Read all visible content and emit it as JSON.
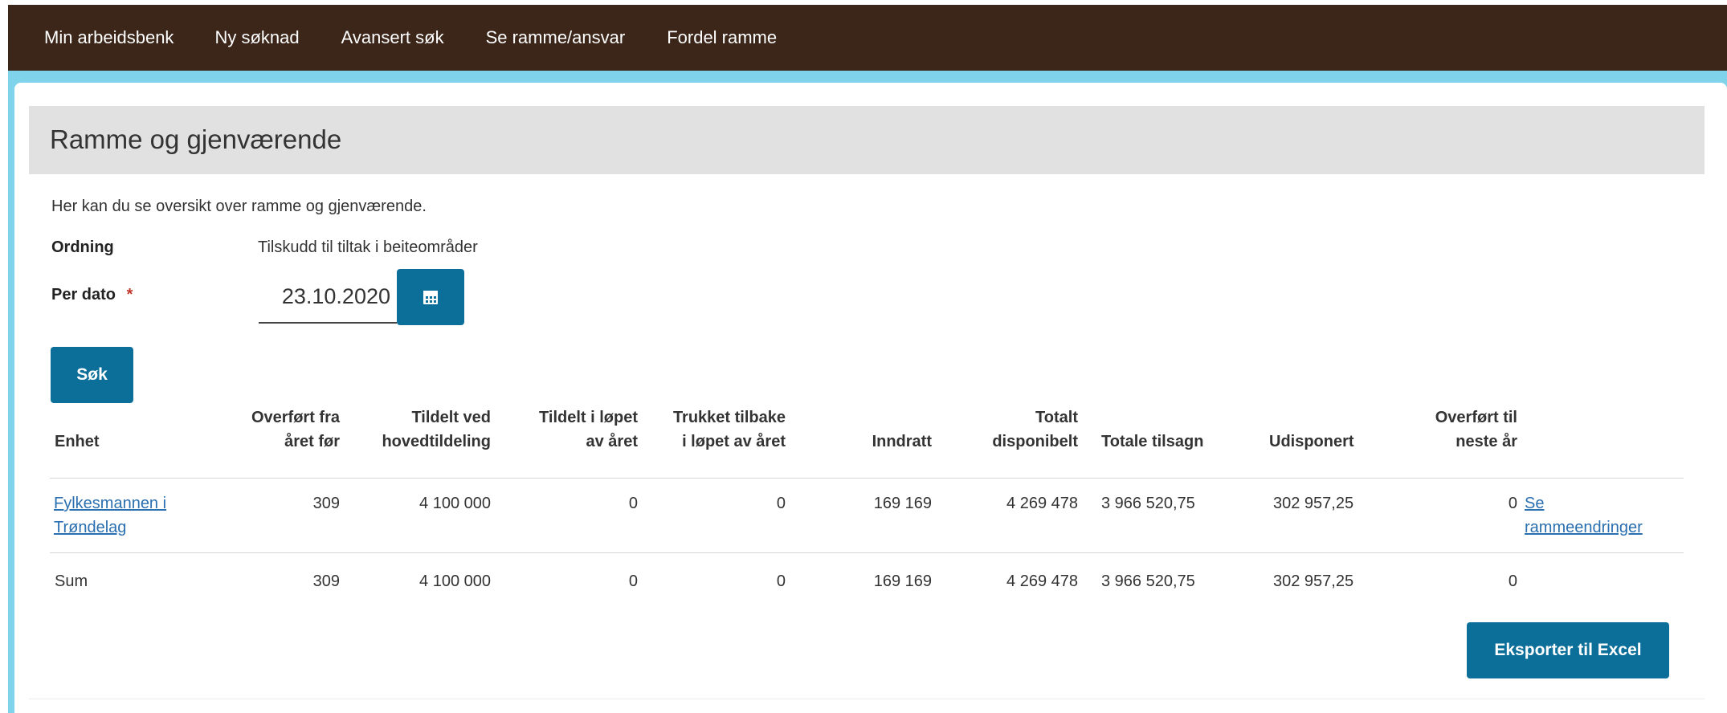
{
  "nav": {
    "items": [
      {
        "label": "Min arbeidsbenk"
      },
      {
        "label": "Ny søknad"
      },
      {
        "label": "Avansert søk"
      },
      {
        "label": "Se ramme/ansvar"
      },
      {
        "label": "Fordel ramme"
      }
    ]
  },
  "page": {
    "title": "Ramme og gjenværende",
    "intro": "Her kan du se oversikt over ramme og gjenværende."
  },
  "form": {
    "ordning_label": "Ordning",
    "ordning_value": "Tilskudd til tiltak i beiteområder",
    "per_dato_label": "Per dato",
    "required_mark": "*",
    "per_dato_value": "23.10.2020",
    "calendar_icon": "calendar-icon",
    "search_label": "Søk"
  },
  "table": {
    "headers": [
      "Enhet",
      "Overført fra\nåret før",
      "Tildelt ved\nhovedtildeling",
      "Tildelt i løpet\nav året",
      "Trukket tilbake\ni løpet av året",
      "Inndratt",
      "Totalt\ndisponibelt",
      "Totale tilsagn",
      "Udisponert",
      "Overført til\nneste år"
    ],
    "rows": [
      {
        "enhet": "Fylkesmannen i\nTrøndelag",
        "overfort_fra": "309",
        "tildelt_hoved": "4 100 000",
        "tildelt_lopet": "0",
        "trukket": "0",
        "inndratt": "169 169",
        "totalt": "4 269 478",
        "tilsagn": "3 966 520,75",
        "udisponert": "302 957,25",
        "overfort_til": "0",
        "link": "Se\nrammeendringer"
      },
      {
        "enhet": "Sum",
        "overfort_fra": "309",
        "tildelt_hoved": "4 100 000",
        "tildelt_lopet": "0",
        "trukket": "0",
        "inndratt": "169 169",
        "totalt": "4 269 478",
        "tilsagn": "3 966 520,75",
        "udisponert": "302 957,25",
        "overfort_til": "0"
      }
    ]
  },
  "actions": {
    "export_label": "Eksporter til Excel"
  },
  "colors": {
    "topbar": "#3b2619",
    "accent": "#0c6f9a",
    "frame": "#7fd3ea",
    "link": "#2a6fb0"
  }
}
